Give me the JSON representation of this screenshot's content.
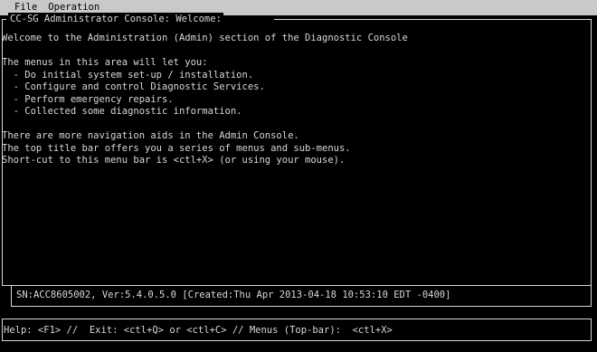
{
  "menu": {
    "items": [
      "File",
      "Operation"
    ]
  },
  "main_panel": {
    "title": "CC-SG Administrator Console: Welcome:",
    "lines": [
      "Welcome to the Administration (Admin) section of the Diagnostic Console",
      "",
      "The menus in this area will let you:",
      "  - Do initial system set-up / installation.",
      "  - Configure and control Diagnostic Services.",
      "  - Perform emergency repairs.",
      "  - Collected some diagnostic information.",
      "",
      "There are more navigation aids in the Admin Console.",
      "The top title bar offers you a series of menus and sub-menus.",
      "Short-cut to this menu bar is <ctl+X> (or using your mouse)."
    ]
  },
  "status_bar": {
    "text": "SN:ACC8605002, Ver:5.4.0.5.0 [Created:Thu Apr 2013-04-18 10:53:10 EDT -0400]"
  },
  "help_bar": {
    "text": "Help: <F1> //  Exit: <ctl+Q> or <ctl+C> // Menus (Top-bar):  <ctl+X>"
  }
}
